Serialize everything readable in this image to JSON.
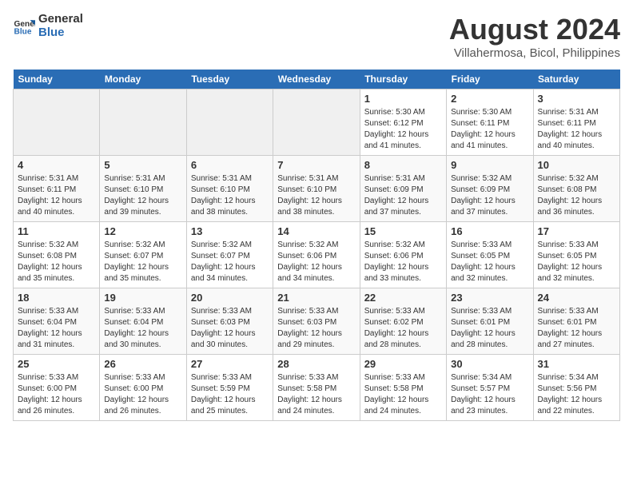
{
  "header": {
    "logo_line1": "General",
    "logo_line2": "Blue",
    "main_title": "August 2024",
    "subtitle": "Villahermosa, Bicol, Philippines"
  },
  "days_of_week": [
    "Sunday",
    "Monday",
    "Tuesday",
    "Wednesday",
    "Thursday",
    "Friday",
    "Saturday"
  ],
  "weeks": [
    [
      {
        "day": "",
        "info": ""
      },
      {
        "day": "",
        "info": ""
      },
      {
        "day": "",
        "info": ""
      },
      {
        "day": "",
        "info": ""
      },
      {
        "day": "1",
        "info": "Sunrise: 5:30 AM\nSunset: 6:12 PM\nDaylight: 12 hours\nand 41 minutes."
      },
      {
        "day": "2",
        "info": "Sunrise: 5:30 AM\nSunset: 6:11 PM\nDaylight: 12 hours\nand 41 minutes."
      },
      {
        "day": "3",
        "info": "Sunrise: 5:31 AM\nSunset: 6:11 PM\nDaylight: 12 hours\nand 40 minutes."
      }
    ],
    [
      {
        "day": "4",
        "info": "Sunrise: 5:31 AM\nSunset: 6:11 PM\nDaylight: 12 hours\nand 40 minutes."
      },
      {
        "day": "5",
        "info": "Sunrise: 5:31 AM\nSunset: 6:10 PM\nDaylight: 12 hours\nand 39 minutes."
      },
      {
        "day": "6",
        "info": "Sunrise: 5:31 AM\nSunset: 6:10 PM\nDaylight: 12 hours\nand 38 minutes."
      },
      {
        "day": "7",
        "info": "Sunrise: 5:31 AM\nSunset: 6:10 PM\nDaylight: 12 hours\nand 38 minutes."
      },
      {
        "day": "8",
        "info": "Sunrise: 5:31 AM\nSunset: 6:09 PM\nDaylight: 12 hours\nand 37 minutes."
      },
      {
        "day": "9",
        "info": "Sunrise: 5:32 AM\nSunset: 6:09 PM\nDaylight: 12 hours\nand 37 minutes."
      },
      {
        "day": "10",
        "info": "Sunrise: 5:32 AM\nSunset: 6:08 PM\nDaylight: 12 hours\nand 36 minutes."
      }
    ],
    [
      {
        "day": "11",
        "info": "Sunrise: 5:32 AM\nSunset: 6:08 PM\nDaylight: 12 hours\nand 35 minutes."
      },
      {
        "day": "12",
        "info": "Sunrise: 5:32 AM\nSunset: 6:07 PM\nDaylight: 12 hours\nand 35 minutes."
      },
      {
        "day": "13",
        "info": "Sunrise: 5:32 AM\nSunset: 6:07 PM\nDaylight: 12 hours\nand 34 minutes."
      },
      {
        "day": "14",
        "info": "Sunrise: 5:32 AM\nSunset: 6:06 PM\nDaylight: 12 hours\nand 34 minutes."
      },
      {
        "day": "15",
        "info": "Sunrise: 5:32 AM\nSunset: 6:06 PM\nDaylight: 12 hours\nand 33 minutes."
      },
      {
        "day": "16",
        "info": "Sunrise: 5:33 AM\nSunset: 6:05 PM\nDaylight: 12 hours\nand 32 minutes."
      },
      {
        "day": "17",
        "info": "Sunrise: 5:33 AM\nSunset: 6:05 PM\nDaylight: 12 hours\nand 32 minutes."
      }
    ],
    [
      {
        "day": "18",
        "info": "Sunrise: 5:33 AM\nSunset: 6:04 PM\nDaylight: 12 hours\nand 31 minutes."
      },
      {
        "day": "19",
        "info": "Sunrise: 5:33 AM\nSunset: 6:04 PM\nDaylight: 12 hours\nand 30 minutes."
      },
      {
        "day": "20",
        "info": "Sunrise: 5:33 AM\nSunset: 6:03 PM\nDaylight: 12 hours\nand 30 minutes."
      },
      {
        "day": "21",
        "info": "Sunrise: 5:33 AM\nSunset: 6:03 PM\nDaylight: 12 hours\nand 29 minutes."
      },
      {
        "day": "22",
        "info": "Sunrise: 5:33 AM\nSunset: 6:02 PM\nDaylight: 12 hours\nand 28 minutes."
      },
      {
        "day": "23",
        "info": "Sunrise: 5:33 AM\nSunset: 6:01 PM\nDaylight: 12 hours\nand 28 minutes."
      },
      {
        "day": "24",
        "info": "Sunrise: 5:33 AM\nSunset: 6:01 PM\nDaylight: 12 hours\nand 27 minutes."
      }
    ],
    [
      {
        "day": "25",
        "info": "Sunrise: 5:33 AM\nSunset: 6:00 PM\nDaylight: 12 hours\nand 26 minutes."
      },
      {
        "day": "26",
        "info": "Sunrise: 5:33 AM\nSunset: 6:00 PM\nDaylight: 12 hours\nand 26 minutes."
      },
      {
        "day": "27",
        "info": "Sunrise: 5:33 AM\nSunset: 5:59 PM\nDaylight: 12 hours\nand 25 minutes."
      },
      {
        "day": "28",
        "info": "Sunrise: 5:33 AM\nSunset: 5:58 PM\nDaylight: 12 hours\nand 24 minutes."
      },
      {
        "day": "29",
        "info": "Sunrise: 5:33 AM\nSunset: 5:58 PM\nDaylight: 12 hours\nand 24 minutes."
      },
      {
        "day": "30",
        "info": "Sunrise: 5:34 AM\nSunset: 5:57 PM\nDaylight: 12 hours\nand 23 minutes."
      },
      {
        "day": "31",
        "info": "Sunrise: 5:34 AM\nSunset: 5:56 PM\nDaylight: 12 hours\nand 22 minutes."
      }
    ]
  ]
}
